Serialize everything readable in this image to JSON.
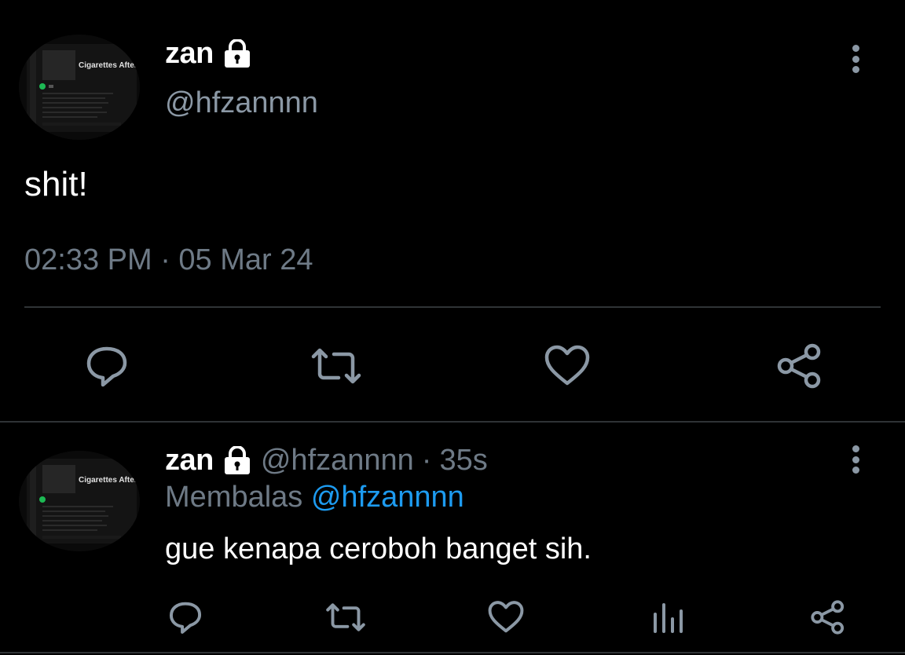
{
  "main_tweet": {
    "display_name": "zan",
    "protected_icon": "lock-icon",
    "handle": "@hfzannnn",
    "text": "shit!",
    "timestamp": "02:33 PM · 05 Mar 24",
    "avatar_text": {
      "title": "Cigarettes After Sex"
    },
    "actions": [
      "reply-icon",
      "retweet-icon",
      "like-icon",
      "share-icon"
    ],
    "menu_icon": "more-vertical-icon"
  },
  "reply_tweet": {
    "display_name": "zan",
    "protected_icon": "lock-icon",
    "handle": "@hfzannnn",
    "separator": "·",
    "age": "35s",
    "replying_to_label": "Membalas",
    "replying_to_handle": "@hfzannnn",
    "text": "gue kenapa ceroboh banget sih.",
    "avatar_text": {
      "title": "Cigarettes After Sex"
    },
    "actions": [
      "reply-icon",
      "retweet-icon",
      "like-icon",
      "views-icon",
      "share-icon"
    ],
    "menu_icon": "more-vertical-icon"
  },
  "colors": {
    "background": "#000000",
    "primary_text": "#ffffff",
    "secondary_text": "#6e7a86",
    "icon": "#8b98a5",
    "divider": "#2f3336",
    "mention": "#1d9bf0"
  }
}
